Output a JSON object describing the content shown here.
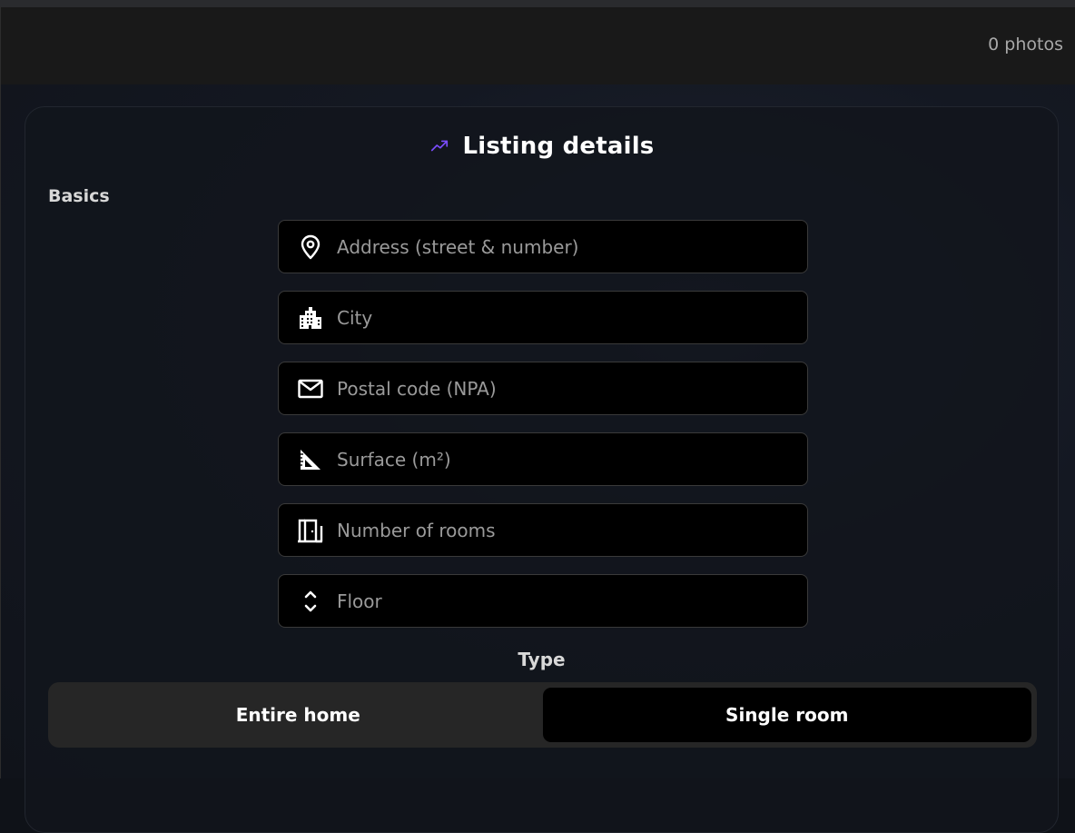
{
  "header": {
    "photo_count": "0 photos"
  },
  "card": {
    "title": "Listing details",
    "title_icon": "trending-up-icon",
    "section_label": "Basics"
  },
  "fields": {
    "address": {
      "placeholder": "Address (street & number)",
      "value": "",
      "icon": "map-pin-icon"
    },
    "city": {
      "placeholder": "City",
      "value": "",
      "icon": "city-buildings-icon"
    },
    "postal_code": {
      "placeholder": "Postal code (NPA)",
      "value": "",
      "icon": "envelope-icon"
    },
    "surface": {
      "placeholder": "Surface (m²)",
      "value": "",
      "icon": "set-square-icon"
    },
    "rooms": {
      "placeholder": "Number of rooms",
      "value": "",
      "icon": "door-icon"
    },
    "floor": {
      "placeholder": "Floor",
      "value": "",
      "icon": "up-down-chevrons-icon"
    }
  },
  "type": {
    "label": "Type",
    "options": [
      "Entire home",
      "Single room"
    ],
    "selected": "Single room"
  },
  "colors": {
    "accent": "#7c4dff",
    "field_bg": "#000000",
    "segment_bg": "#262626"
  }
}
